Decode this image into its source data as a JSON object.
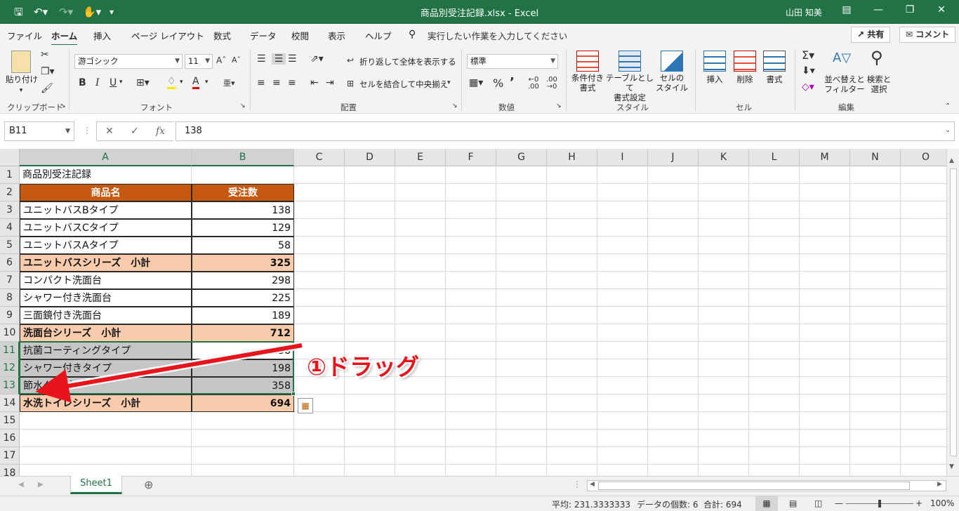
{
  "window": {
    "title": "商品別受注記録.xlsx  -  Excel",
    "user": "山田 知美"
  },
  "menu": {
    "tabs": [
      "ファイル",
      "ホーム",
      "挿入",
      "ページ レイアウト",
      "数式",
      "データ",
      "校閲",
      "表示",
      "ヘルプ"
    ],
    "tell_me": "実行したい作業を入力してください",
    "share": "共有",
    "comment": "コメント"
  },
  "ribbon": {
    "groups": [
      "クリップボード",
      "フォント",
      "配置",
      "数値",
      "スタイル",
      "セル",
      "編集"
    ],
    "paste": "貼り付け",
    "font_name": "游ゴシック",
    "font_size": "11",
    "wrap_text": "折り返して全体を表示する",
    "merge_center": "セルを結合して中央揃え",
    "number_format": "標準",
    "cond_format": "条件付き\n書式",
    "format_table": "テーブルとして\n書式設定",
    "cell_styles": "セルの\nスタイル",
    "insert": "挿入",
    "delete": "削除",
    "format": "書式",
    "sort_filter": "並べ替えと\nフィルター",
    "find_select": "検索と\n選択",
    "bold": "B",
    "italic": "I",
    "underline": "U"
  },
  "formula_bar": {
    "name_box": "B11",
    "cancel": "✕",
    "enter": "✓",
    "fx": "fx",
    "value": "138"
  },
  "columns": [
    "A",
    "B",
    "C",
    "D",
    "E",
    "F",
    "G",
    "H",
    "I",
    "J",
    "K",
    "L",
    "M",
    "N",
    "O"
  ],
  "rows": [
    {
      "n": "1",
      "a": "商品別受注記録",
      "b": "",
      "style": "title"
    },
    {
      "n": "2",
      "a": "商品名",
      "b": "受注数",
      "style": "header"
    },
    {
      "n": "3",
      "a": "ユニットバスBタイプ",
      "b": "138",
      "style": "normal"
    },
    {
      "n": "4",
      "a": "ユニットバスCタイプ",
      "b": "129",
      "style": "normal"
    },
    {
      "n": "5",
      "a": "ユニットバスAタイプ",
      "b": "58",
      "style": "normal"
    },
    {
      "n": "6",
      "a": "ユニットバスシリーズ　小計",
      "b": "325",
      "style": "subtotal"
    },
    {
      "n": "7",
      "a": "コンパクト洗面台",
      "b": "298",
      "style": "normal"
    },
    {
      "n": "8",
      "a": "シャワー付き洗面台",
      "b": "225",
      "style": "normal"
    },
    {
      "n": "9",
      "a": "三面鏡付き洗面台",
      "b": "189",
      "style": "normal"
    },
    {
      "n": "10",
      "a": "洗面台シリーズ　小計",
      "b": "712",
      "style": "subtotal"
    },
    {
      "n": "11",
      "a": "抗菌コーティングタイプ",
      "b": "138",
      "style": "selected"
    },
    {
      "n": "12",
      "a": "シャワー付きタイプ",
      "b": "198",
      "style": "selected"
    },
    {
      "n": "13",
      "a": "節水タイプ",
      "b": "358",
      "style": "selected"
    },
    {
      "n": "14",
      "a": "水洗トイレシリーズ　小計",
      "b": "694",
      "style": "subtotal"
    },
    {
      "n": "15",
      "a": "",
      "b": "",
      "style": "empty"
    },
    {
      "n": "16",
      "a": "",
      "b": "",
      "style": "empty"
    },
    {
      "n": "17",
      "a": "",
      "b": "",
      "style": "empty"
    },
    {
      "n": "18",
      "a": "",
      "b": "",
      "style": "empty"
    }
  ],
  "sheet": {
    "tab": "Sheet1"
  },
  "status": {
    "average": "平均: 231.3333333",
    "count": "データの個数: 6",
    "sum": "合計: 694",
    "zoom": "100%"
  },
  "annotation": {
    "label": "①ドラッグ",
    "color": "#e8141c"
  },
  "colors": {
    "accent": "#217346",
    "header_fill": "#c65911",
    "subtotal_fill": "#f8cbad",
    "selection_fill": "#c6c6c6"
  }
}
